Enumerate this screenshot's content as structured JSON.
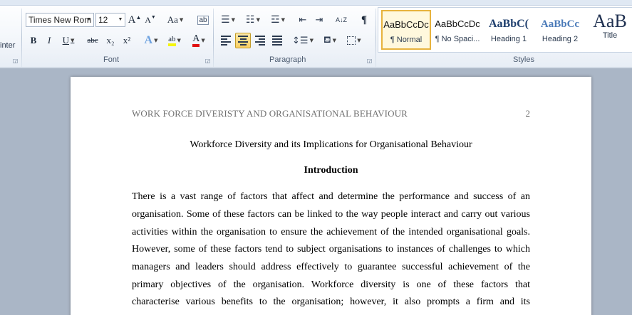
{
  "ribbon": {
    "clipboard": {
      "painter_label": "inter"
    },
    "font": {
      "group_label": "Font",
      "font_name": "Times New Rom",
      "font_size": "12",
      "grow_label": "A",
      "shrink_label": "A",
      "change_case_label": "Aa",
      "bold_label": "B",
      "italic_label": "I",
      "underline_label": "U",
      "strike_label": "abc",
      "subscript_label": "x₂",
      "superscript_label": "x²",
      "text_effects_label": "A",
      "highlight_label": "ab",
      "font_color_label": "A",
      "highlight_color": "#f5f50a",
      "font_color": "#e01010"
    },
    "paragraph": {
      "group_label": "Paragraph",
      "sort_label": "A↓Z",
      "pilcrow_label": "¶"
    },
    "styles": {
      "group_label": "Styles",
      "items": [
        {
          "sample": "AaBbCcDc",
          "name": "¶ Normal"
        },
        {
          "sample": "AaBbCcDc",
          "name": "¶ No Spaci..."
        },
        {
          "sample": "AaBbC(",
          "name": "Heading 1"
        },
        {
          "sample": "AaBbCc",
          "name": "Heading 2"
        },
        {
          "sample": "AaB",
          "name": "Title"
        }
      ]
    }
  },
  "document": {
    "header_text": "WORK FORCE DIVERISTY AND ORGANISATIONAL BEHAVIOUR",
    "page_number": "2",
    "title": "Workforce Diversity and its Implications for Organisational  Behaviour",
    "heading": "Introduction",
    "lines": [
      "There is a vast range of factors that affect and determine the performance and success of an",
      "organisation. Some of these factors can be linked to the way people interact and carry out various",
      "activities within the organisation to ensure the achievement of the intended organisational goals.",
      "However, some of these factors tend to subject organisations to instances of challenges to which",
      "managers and leaders should address effectively to guarantee successful achievement of the",
      "primary objectives of the organisation. Workforce diversity is one of these factors that",
      "characterise various benefits to the organisation; however, it also prompts a firm and its"
    ]
  }
}
